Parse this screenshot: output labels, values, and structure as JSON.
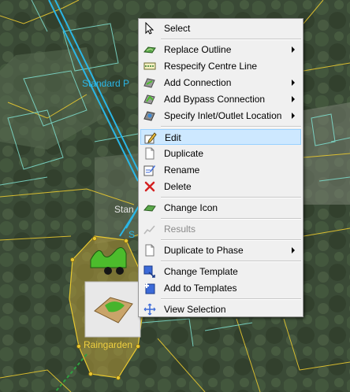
{
  "map": {
    "labels": {
      "standard_p": "Standard P",
      "stan": "Stan",
      "s": "S",
      "raingarden": "Raingarden"
    }
  },
  "colors": {
    "menu_bg": "#f0f0f0",
    "highlight": "#cde8ff",
    "cyan": "#2ab6e6",
    "yellow": "#e8c830"
  },
  "menu": {
    "select": "Select",
    "replace_outline": "Replace Outline",
    "respecify_centre_line": "Respecify Centre Line",
    "add_connection": "Add Connection",
    "add_bypass_connection": "Add Bypass Connection",
    "specify_inlet_outlet": "Specify Inlet/Outlet Location",
    "edit": "Edit",
    "duplicate": "Duplicate",
    "rename": "Rename",
    "delete": "Delete",
    "change_icon": "Change Icon",
    "results": "Results",
    "duplicate_to_phase": "Duplicate to Phase",
    "change_template": "Change Template",
    "add_to_templates": "Add to Templates",
    "view_selection": "View Selection"
  }
}
